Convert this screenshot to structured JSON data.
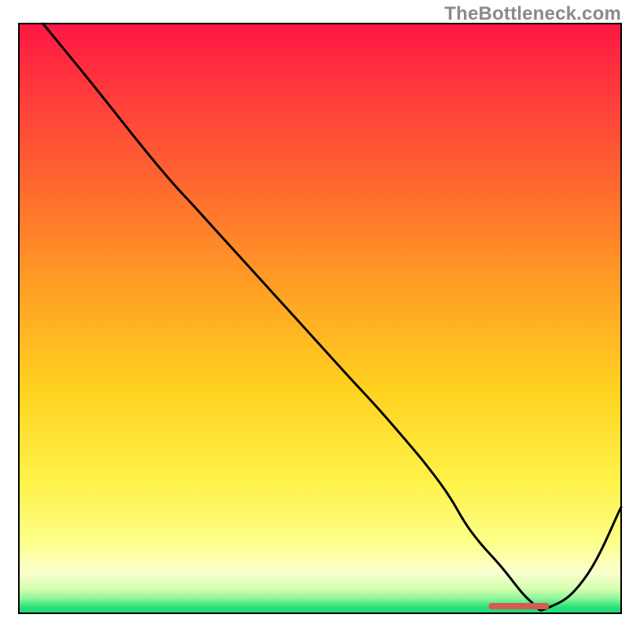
{
  "watermark": "TheBottleneck.com",
  "chart_data": {
    "type": "line",
    "title": "",
    "xlabel": "",
    "ylabel": "",
    "xlim": [
      0,
      100
    ],
    "ylim": [
      0,
      100
    ],
    "grid": false,
    "legend": false,
    "gradient_stops": [
      {
        "offset": 0.0,
        "color": "#ff1744"
      },
      {
        "offset": 0.12,
        "color": "#ff3b3b"
      },
      {
        "offset": 0.28,
        "color": "#ff6a2f"
      },
      {
        "offset": 0.45,
        "color": "#ffa024"
      },
      {
        "offset": 0.62,
        "color": "#ffd21f"
      },
      {
        "offset": 0.78,
        "color": "#fff24a"
      },
      {
        "offset": 0.88,
        "color": "#fcff8a"
      },
      {
        "offset": 0.93,
        "color": "#faffd0"
      },
      {
        "offset": 0.958,
        "color": "#d6ffb0"
      },
      {
        "offset": 0.975,
        "color": "#8ef59a"
      },
      {
        "offset": 0.99,
        "color": "#28e07a"
      },
      {
        "offset": 1.0,
        "color": "#1fd674"
      }
    ],
    "series": [
      {
        "name": "bottleneck-curve",
        "x": [
          4,
          12,
          23,
          30,
          38,
          46,
          54,
          62,
          70,
          75,
          80,
          85,
          88,
          94,
          100
        ],
        "y": [
          100,
          90,
          76,
          68,
          59,
          50,
          41,
          32,
          22,
          14,
          8,
          2,
          1,
          6,
          18
        ]
      }
    ],
    "marker": {
      "name": "optimal-range",
      "x_start": 78,
      "x_end": 88,
      "y": 1.2,
      "color": "#d45a52"
    }
  }
}
